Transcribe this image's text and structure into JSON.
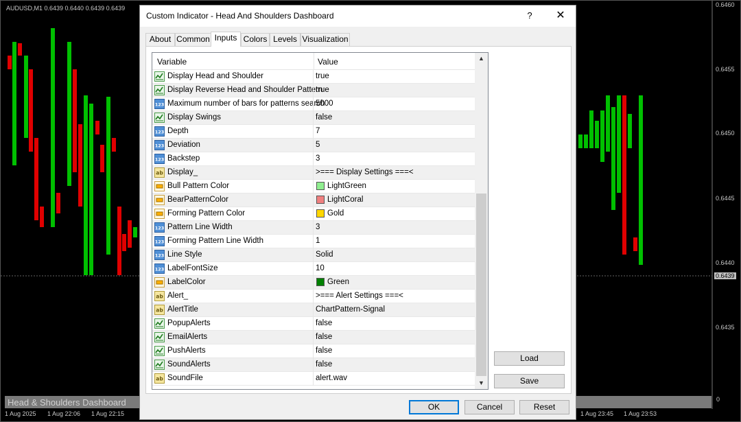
{
  "chart": {
    "symbol_text": "AUDUSD,M1  0.6439 0.6440 0.6439 0.6439",
    "footer_title": "Head & Shoulders Dashboard",
    "footer_zero": "0",
    "current_price": "0.6439",
    "price_labels": [
      "0.6460",
      "0.6455",
      "0.6450",
      "0.6445",
      "0.6440",
      "0.6435"
    ],
    "time_labels": [
      "1 Aug 2025",
      "1 Aug 22:06",
      "1 Aug 22:15",
      "1 Aug 23:45",
      "1 Aug 23:53"
    ],
    "colors": {
      "bull": "#00c000",
      "bear": "#e00000"
    }
  },
  "dialog": {
    "title": "Custom Indicator - Head And Shoulders Dashboard",
    "help_glyph": "?",
    "close_glyph": "✕",
    "tabs": [
      "About",
      "Common",
      "Inputs",
      "Colors",
      "Levels",
      "Visualization"
    ],
    "active_tab": "Inputs",
    "grid": {
      "headers": {
        "variable": "Variable",
        "value": "Value"
      },
      "rows": [
        {
          "icon": "bool-icon",
          "variable": "Display Head and Shoulder",
          "value": "true"
        },
        {
          "icon": "bool-icon",
          "variable": "Display Reverse Head and Shoulder Pattern",
          "value": "true"
        },
        {
          "icon": "int-icon",
          "variable": "Maximum number of bars for patterns search",
          "value": "5000"
        },
        {
          "icon": "bool-icon",
          "variable": "Display Swings",
          "value": "false"
        },
        {
          "icon": "int-icon",
          "variable": "Depth",
          "value": "7"
        },
        {
          "icon": "int-icon",
          "variable": "Deviation",
          "value": "5"
        },
        {
          "icon": "int-icon",
          "variable": "Backstep",
          "value": "3"
        },
        {
          "icon": "string-icon",
          "variable": "Display_",
          "value": ">=== Display Settings ===<"
        },
        {
          "icon": "color-icon",
          "variable": "Bull Pattern Color",
          "value": "LightGreen",
          "swatch": "#90ee90"
        },
        {
          "icon": "color-icon",
          "variable": "BearPatternColor",
          "value": "LightCoral",
          "swatch": "#f08080"
        },
        {
          "icon": "color-icon",
          "variable": "Forming Pattern Color",
          "value": "Gold",
          "swatch": "#ffd700"
        },
        {
          "icon": "int-icon",
          "variable": "Pattern Line Width",
          "value": "3"
        },
        {
          "icon": "int-icon",
          "variable": "Forming Pattern Line Width",
          "value": "1"
        },
        {
          "icon": "int-icon",
          "variable": "Line Style",
          "value": "Solid"
        },
        {
          "icon": "int-icon",
          "variable": "LabelFontSize",
          "value": "10"
        },
        {
          "icon": "color-icon",
          "variable": "LabelColor",
          "value": "Green",
          "swatch": "#008000"
        },
        {
          "icon": "string-icon",
          "variable": "Alert_",
          "value": ">=== Alert Settings ===<"
        },
        {
          "icon": "string-icon",
          "variable": "AlertTitle",
          "value": "ChartPattern-Signal"
        },
        {
          "icon": "bool-icon",
          "variable": "PopupAlerts",
          "value": "false"
        },
        {
          "icon": "bool-icon",
          "variable": "EmailAlerts",
          "value": "false"
        },
        {
          "icon": "bool-icon",
          "variable": "PushAlerts",
          "value": "false"
        },
        {
          "icon": "bool-icon",
          "variable": "SoundAlerts",
          "value": "false"
        },
        {
          "icon": "string-icon",
          "variable": "SoundFile",
          "value": "alert.wav"
        }
      ]
    },
    "buttons": {
      "load": "Load",
      "save": "Save",
      "ok": "OK",
      "cancel": "Cancel",
      "reset": "Reset"
    }
  }
}
